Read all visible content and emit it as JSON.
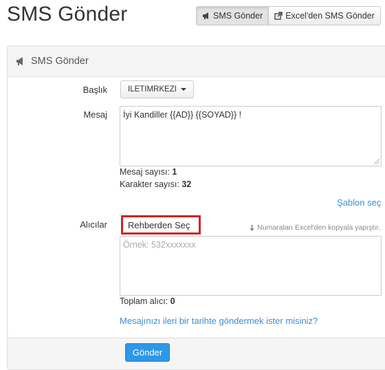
{
  "header": {
    "title": "SMS Gönder",
    "buttons": [
      {
        "label": "SMS Gönder",
        "icon": "bullhorn-icon",
        "active": true
      },
      {
        "label": "Excel'den SMS Gönder",
        "icon": "external-link-icon",
        "active": false
      }
    ]
  },
  "panel": {
    "title": "SMS Gönder",
    "icon": "bullhorn-icon",
    "baslik": {
      "label": "Başlık",
      "selected": "ILETIMRKEZI"
    },
    "mesaj": {
      "label": "Mesaj",
      "value": "İyi Kandiller {{AD}} {{SOYAD}} !",
      "count_label": "Mesaj sayısı:",
      "count_value": "1",
      "char_label": "Karakter sayısı:",
      "char_value": "32"
    },
    "template_link": "Şablon seç",
    "alicilar": {
      "label": "Alıcılar",
      "contacts_button": "Rehberden Seç",
      "hint": "Numaraları Excel'den kopyala yapıştır.",
      "placeholder": "Örnek: 532xxxxxxx",
      "total_label": "Toplam alıcı:",
      "total_value": "0"
    },
    "schedule_link": "Mesajınızı ileri bir tarihte göndermek ister misiniz?",
    "submit": "Gönder"
  },
  "colors": {
    "link": "#3a8fd6",
    "primary": "#2d97e8",
    "highlight": "#d02323"
  }
}
